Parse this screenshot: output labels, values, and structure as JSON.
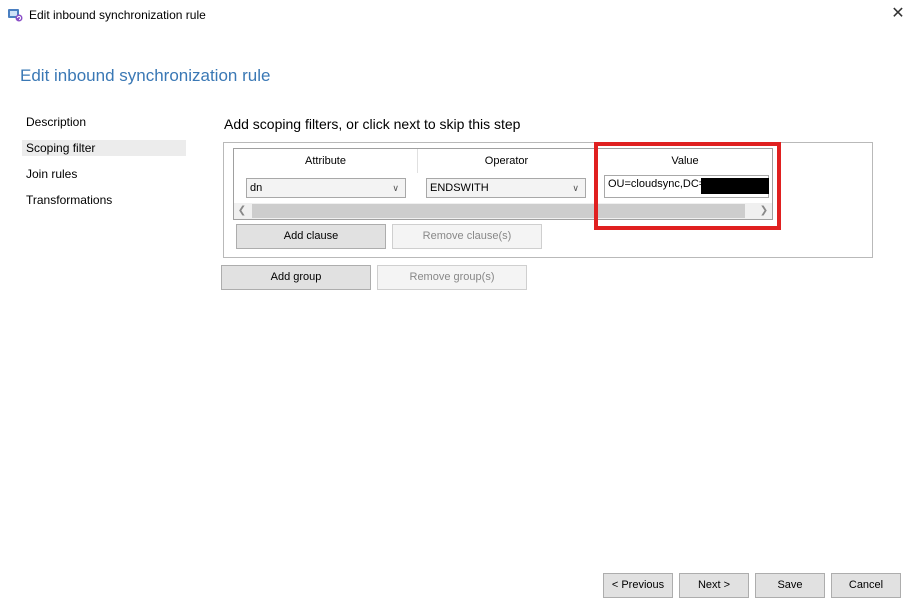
{
  "window": {
    "title": "Edit inbound synchronization rule",
    "close_glyph": "✕"
  },
  "page": {
    "heading": "Edit inbound synchronization rule"
  },
  "nav": {
    "items": [
      {
        "label": "Description",
        "selected": false
      },
      {
        "label": "Scoping filter",
        "selected": true
      },
      {
        "label": "Join rules",
        "selected": false
      },
      {
        "label": "Transformations",
        "selected": false
      }
    ]
  },
  "scoping": {
    "title": "Add scoping filters, or click next to skip this step",
    "columns": [
      "Attribute",
      "Operator",
      "Value"
    ],
    "row": {
      "attribute": "dn",
      "operator": "ENDSWITH",
      "value": "OU=cloudsync,DC="
    },
    "add_clause": "Add clause",
    "remove_clause": "Remove clause(s)",
    "add_group": "Add group",
    "remove_group": "Remove group(s)"
  },
  "footer": {
    "previous": "< Previous",
    "next": "Next >",
    "save": "Save",
    "cancel": "Cancel"
  },
  "colors": {
    "heading": "#3a78b5",
    "highlight": "#e02020"
  },
  "icons": {
    "app": "sync-app-icon",
    "close": "close-icon"
  }
}
